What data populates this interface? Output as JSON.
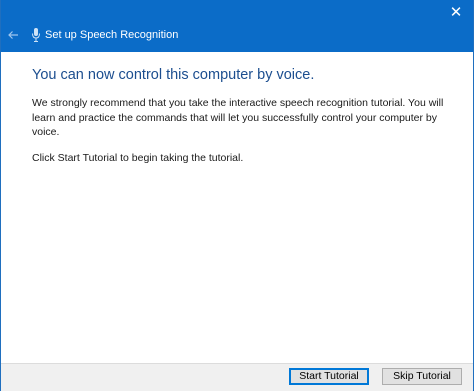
{
  "window": {
    "title": "Set up Speech Recognition",
    "close_glyph": "✕",
    "accent_color": "#0b6cc8"
  },
  "main": {
    "heading": "You can now control this computer by voice.",
    "paragraph1": "We strongly recommend that you take the interactive speech recognition tutorial. You will learn and practice the commands that will let you successfully control your computer by voice.",
    "paragraph2": "Click Start Tutorial to begin taking the tutorial."
  },
  "footer": {
    "start_label": "Start Tutorial",
    "skip_label": "Skip Tutorial"
  },
  "icons": {
    "back": "back-arrow-icon",
    "title": "microphone-icon",
    "close": "close-icon"
  }
}
